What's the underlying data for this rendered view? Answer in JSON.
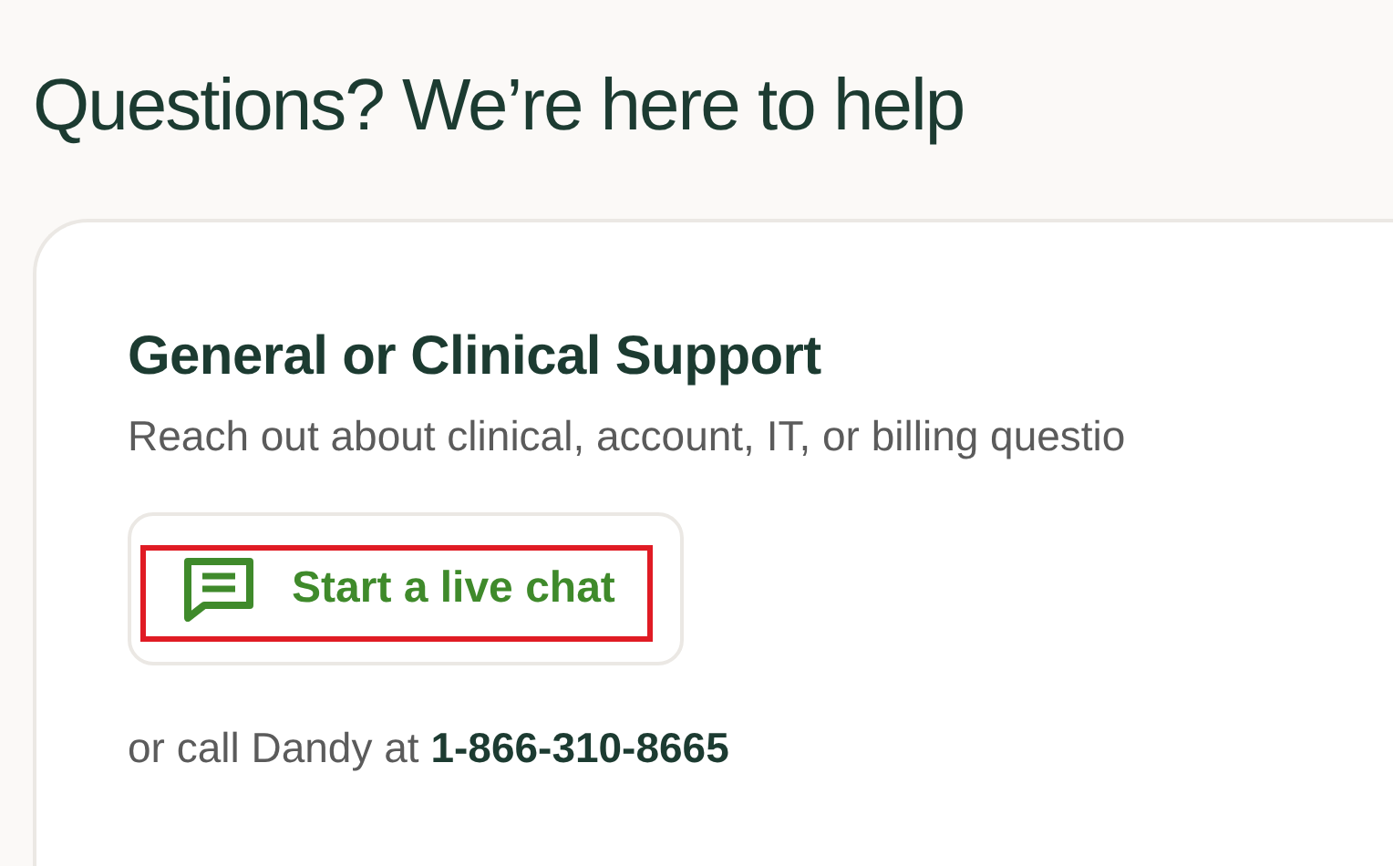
{
  "heading": "Questions? We’re here to help",
  "card": {
    "title": "General or Clinical Support",
    "description": "Reach out about clinical, account, IT, or billing questio",
    "chat_button": {
      "label": "Start a live chat",
      "highlighted": true
    },
    "phone_note": "or call Dandy at **1-866-310-8665**"
  }
}
